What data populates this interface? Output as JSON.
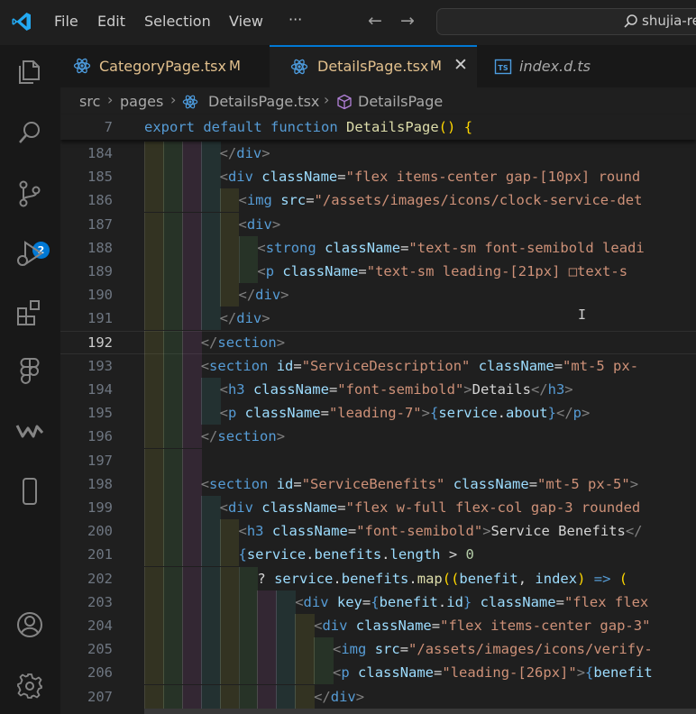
{
  "menu": {
    "items": [
      "File",
      "Edit",
      "Selection",
      "View",
      "···"
    ]
  },
  "nav": {
    "back": "←",
    "forward": "→"
  },
  "search": {
    "text": "shujia-re"
  },
  "activity": {
    "scm_badge": "2"
  },
  "tabs": [
    {
      "label": "CategoryPage.tsx",
      "status": "M",
      "icon": "react-icon",
      "active": false
    },
    {
      "label": "DetailsPage.tsx",
      "status": "M",
      "icon": "react-icon",
      "active": true,
      "close": "✕"
    },
    {
      "label": "index.d.ts",
      "status": "",
      "icon": "ts-icon",
      "active": false
    }
  ],
  "breadcrumb": {
    "folder1": "src",
    "folder2": "pages",
    "file": "DetailsPage.tsx",
    "symbol": "DetailsPage"
  },
  "colors": {
    "accent": "#0078d4",
    "modified": "#e2c08d",
    "keyword": "#569cd6",
    "string": "#ce9178",
    "attribute": "#9cdcfe"
  },
  "sticky_line": {
    "number": "7",
    "tokens": [
      [
        "kw",
        "export"
      ],
      [
        "txt",
        " "
      ],
      [
        "kw",
        "default"
      ],
      [
        "txt",
        " "
      ],
      [
        "kw",
        "function"
      ],
      [
        "txt",
        " "
      ],
      [
        "fn",
        "DetailsPage"
      ],
      [
        "brace",
        "()"
      ],
      [
        "txt",
        " "
      ],
      [
        "brace",
        "{"
      ]
    ]
  },
  "lines": [
    {
      "n": "184",
      "i": 4,
      "t": [
        [
          "punc",
          "</"
        ],
        [
          "tag",
          "div"
        ],
        [
          "punc",
          ">"
        ]
      ]
    },
    {
      "n": "185",
      "i": 4,
      "t": [
        [
          "punc",
          "<"
        ],
        [
          "tag",
          "div"
        ],
        [
          "txt",
          " "
        ],
        [
          "attr",
          "className"
        ],
        [
          "txt",
          "="
        ],
        [
          "str",
          "\"flex items-center gap-[10px] round"
        ]
      ]
    },
    {
      "n": "186",
      "i": 5,
      "t": [
        [
          "punc",
          "<"
        ],
        [
          "tag",
          "img"
        ],
        [
          "txt",
          " "
        ],
        [
          "attr",
          "src"
        ],
        [
          "txt",
          "="
        ],
        [
          "str",
          "\"/assets/images/icons/clock-service-det"
        ]
      ]
    },
    {
      "n": "187",
      "i": 5,
      "t": [
        [
          "punc",
          "<"
        ],
        [
          "tag",
          "div"
        ],
        [
          "punc",
          ">"
        ]
      ]
    },
    {
      "n": "188",
      "i": 6,
      "t": [
        [
          "punc",
          "<"
        ],
        [
          "tag",
          "strong"
        ],
        [
          "txt",
          " "
        ],
        [
          "attr",
          "className"
        ],
        [
          "txt",
          "="
        ],
        [
          "str",
          "\"text-sm font-semibold leadi"
        ]
      ]
    },
    {
      "n": "189",
      "i": 6,
      "t": [
        [
          "punc",
          "<"
        ],
        [
          "tag",
          "p"
        ],
        [
          "txt",
          " "
        ],
        [
          "attr",
          "className"
        ],
        [
          "txt",
          "="
        ],
        [
          "str",
          "\"text-sm leading-[21px] □text-s"
        ]
      ]
    },
    {
      "n": "190",
      "i": 5,
      "t": [
        [
          "punc",
          "</"
        ],
        [
          "tag",
          "div"
        ],
        [
          "punc",
          ">"
        ]
      ]
    },
    {
      "n": "191",
      "i": 4,
      "t": [
        [
          "punc",
          "</"
        ],
        [
          "tag",
          "div"
        ],
        [
          "punc",
          ">"
        ]
      ]
    },
    {
      "n": "192",
      "i": 3,
      "t": [
        [
          "punc",
          "</"
        ],
        [
          "tag",
          "section"
        ],
        [
          "punc",
          ">"
        ]
      ],
      "current": true
    },
    {
      "n": "193",
      "i": 3,
      "t": [
        [
          "punc",
          "<"
        ],
        [
          "tag",
          "section"
        ],
        [
          "txt",
          " "
        ],
        [
          "attr",
          "id"
        ],
        [
          "txt",
          "="
        ],
        [
          "str",
          "\"ServiceDescription\""
        ],
        [
          "txt",
          " "
        ],
        [
          "attr",
          "className"
        ],
        [
          "txt",
          "="
        ],
        [
          "str",
          "\"mt-5 px-"
        ]
      ]
    },
    {
      "n": "194",
      "i": 4,
      "t": [
        [
          "punc",
          "<"
        ],
        [
          "tag",
          "h3"
        ],
        [
          "txt",
          " "
        ],
        [
          "attr",
          "className"
        ],
        [
          "txt",
          "="
        ],
        [
          "str",
          "\"font-semibold\""
        ],
        [
          "punc",
          ">"
        ],
        [
          "txt",
          "Details"
        ],
        [
          "punc",
          "</"
        ],
        [
          "tag",
          "h3"
        ],
        [
          "punc",
          ">"
        ]
      ]
    },
    {
      "n": "195",
      "i": 4,
      "t": [
        [
          "punc",
          "<"
        ],
        [
          "tag",
          "p"
        ],
        [
          "txt",
          " "
        ],
        [
          "attr",
          "className"
        ],
        [
          "txt",
          "="
        ],
        [
          "str",
          "\"leading-7\""
        ],
        [
          "punc",
          ">"
        ],
        [
          "kw",
          "{"
        ],
        [
          "var",
          "service"
        ],
        [
          "txt",
          "."
        ],
        [
          "var",
          "about"
        ],
        [
          "kw",
          "}"
        ],
        [
          "punc",
          "</"
        ],
        [
          "tag",
          "p"
        ],
        [
          "punc",
          ">"
        ]
      ]
    },
    {
      "n": "196",
      "i": 3,
      "t": [
        [
          "punc",
          "</"
        ],
        [
          "tag",
          "section"
        ],
        [
          "punc",
          ">"
        ]
      ]
    },
    {
      "n": "197",
      "i": 0,
      "t": []
    },
    {
      "n": "198",
      "i": 3,
      "t": [
        [
          "punc",
          "<"
        ],
        [
          "tag",
          "section"
        ],
        [
          "txt",
          " "
        ],
        [
          "attr",
          "id"
        ],
        [
          "txt",
          "="
        ],
        [
          "str",
          "\"ServiceBenefits\""
        ],
        [
          "txt",
          " "
        ],
        [
          "attr",
          "className"
        ],
        [
          "txt",
          "="
        ],
        [
          "str",
          "\"mt-5 px-5\""
        ],
        [
          "punc",
          ">"
        ]
      ]
    },
    {
      "n": "199",
      "i": 4,
      "t": [
        [
          "punc",
          "<"
        ],
        [
          "tag",
          "div"
        ],
        [
          "txt",
          " "
        ],
        [
          "attr",
          "className"
        ],
        [
          "txt",
          "="
        ],
        [
          "str",
          "\"flex w-full flex-col gap-3 rounded"
        ]
      ]
    },
    {
      "n": "200",
      "i": 5,
      "t": [
        [
          "punc",
          "<"
        ],
        [
          "tag",
          "h3"
        ],
        [
          "txt",
          " "
        ],
        [
          "attr",
          "className"
        ],
        [
          "txt",
          "="
        ],
        [
          "str",
          "\"font-semibold\""
        ],
        [
          "punc",
          ">"
        ],
        [
          "txt",
          "Service Benefits"
        ],
        [
          "punc",
          "</"
        ]
      ]
    },
    {
      "n": "201",
      "i": 5,
      "t": [
        [
          "kw",
          "{"
        ],
        [
          "var",
          "service"
        ],
        [
          "txt",
          "."
        ],
        [
          "var",
          "benefits"
        ],
        [
          "txt",
          "."
        ],
        [
          "var",
          "length"
        ],
        [
          "txt",
          " > "
        ],
        [
          "num",
          "0"
        ]
      ]
    },
    {
      "n": "202",
      "i": 6,
      "t": [
        [
          "txt",
          "? "
        ],
        [
          "var",
          "service"
        ],
        [
          "txt",
          "."
        ],
        [
          "var",
          "benefits"
        ],
        [
          "txt",
          "."
        ],
        [
          "fnp",
          "map"
        ],
        [
          "brace",
          "(("
        ],
        [
          "var",
          "benefit"
        ],
        [
          "txt",
          ", "
        ],
        [
          "var",
          "index"
        ],
        [
          "brace",
          ")"
        ],
        [
          "txt",
          " "
        ],
        [
          "kw",
          "=>"
        ],
        [
          "txt",
          " "
        ],
        [
          "brace",
          "("
        ]
      ]
    },
    {
      "n": "203",
      "i": 8,
      "t": [
        [
          "punc",
          "<"
        ],
        [
          "tag",
          "div"
        ],
        [
          "txt",
          " "
        ],
        [
          "attr",
          "key"
        ],
        [
          "txt",
          "="
        ],
        [
          "kw",
          "{"
        ],
        [
          "var",
          "benefit"
        ],
        [
          "txt",
          "."
        ],
        [
          "var",
          "id"
        ],
        [
          "kw",
          "}"
        ],
        [
          "txt",
          " "
        ],
        [
          "attr",
          "className"
        ],
        [
          "txt",
          "="
        ],
        [
          "str",
          "\"flex flex"
        ]
      ]
    },
    {
      "n": "204",
      "i": 9,
      "t": [
        [
          "punc",
          "<"
        ],
        [
          "tag",
          "div"
        ],
        [
          "txt",
          " "
        ],
        [
          "attr",
          "className"
        ],
        [
          "txt",
          "="
        ],
        [
          "str",
          "\"flex items-center gap-3\""
        ]
      ]
    },
    {
      "n": "205",
      "i": 10,
      "t": [
        [
          "punc",
          "<"
        ],
        [
          "tag",
          "img"
        ],
        [
          "txt",
          " "
        ],
        [
          "attr",
          "src"
        ],
        [
          "txt",
          "="
        ],
        [
          "str",
          "\"/assets/images/icons/verify-"
        ]
      ]
    },
    {
      "n": "206",
      "i": 10,
      "t": [
        [
          "punc",
          "<"
        ],
        [
          "tag",
          "p"
        ],
        [
          "txt",
          " "
        ],
        [
          "attr",
          "className"
        ],
        [
          "txt",
          "="
        ],
        [
          "str",
          "\"leading-[26px]\""
        ],
        [
          "punc",
          ">"
        ],
        [
          "kw",
          "{"
        ],
        [
          "var",
          "benefit"
        ]
      ]
    },
    {
      "n": "207",
      "i": 9,
      "t": [
        [
          "punc",
          "</"
        ],
        [
          "tag",
          "div"
        ],
        [
          "punc",
          ">"
        ]
      ]
    }
  ],
  "indent_colors": [
    "rgba(255,255,64,0.09)",
    "rgba(127,255,127,0.09)",
    "rgba(255,127,255,0.09)",
    "rgba(79,236,236,0.09)",
    "rgba(255,255,64,0.09)",
    "rgba(127,255,127,0.09)",
    "rgba(255,127,255,0.09)",
    "rgba(79,236,236,0.09)",
    "rgba(255,255,64,0.09)",
    "rgba(127,255,127,0.09)"
  ]
}
